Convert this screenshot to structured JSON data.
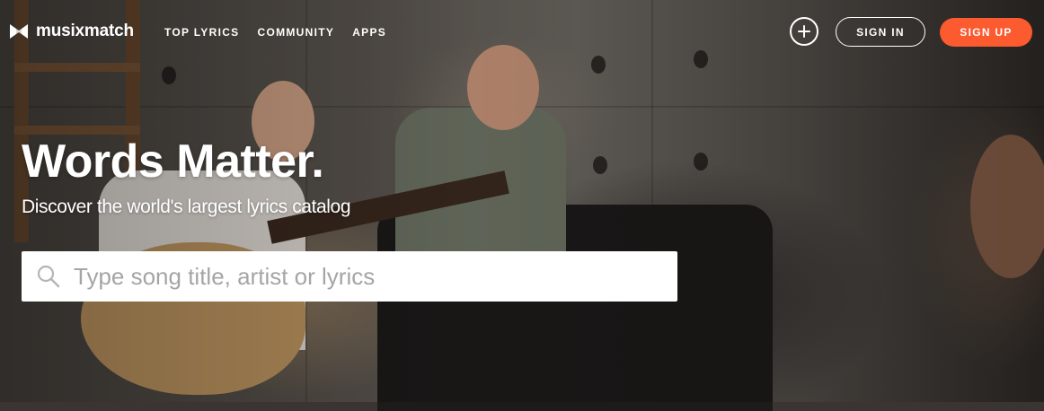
{
  "brand": {
    "name": "musixmatch",
    "accent": "#fc5a2f"
  },
  "nav": {
    "links": [
      "TOP LYRICS",
      "COMMUNITY",
      "APPS"
    ],
    "add_icon": "plus-icon",
    "sign_in": "SIGN IN",
    "sign_up": "SIGN UP"
  },
  "hero": {
    "headline": "Words Matter.",
    "subheadline": "Discover the world's largest lyrics catalog"
  },
  "search": {
    "placeholder": "Type song title, artist or lyrics",
    "value": "",
    "icon": "search-icon"
  }
}
